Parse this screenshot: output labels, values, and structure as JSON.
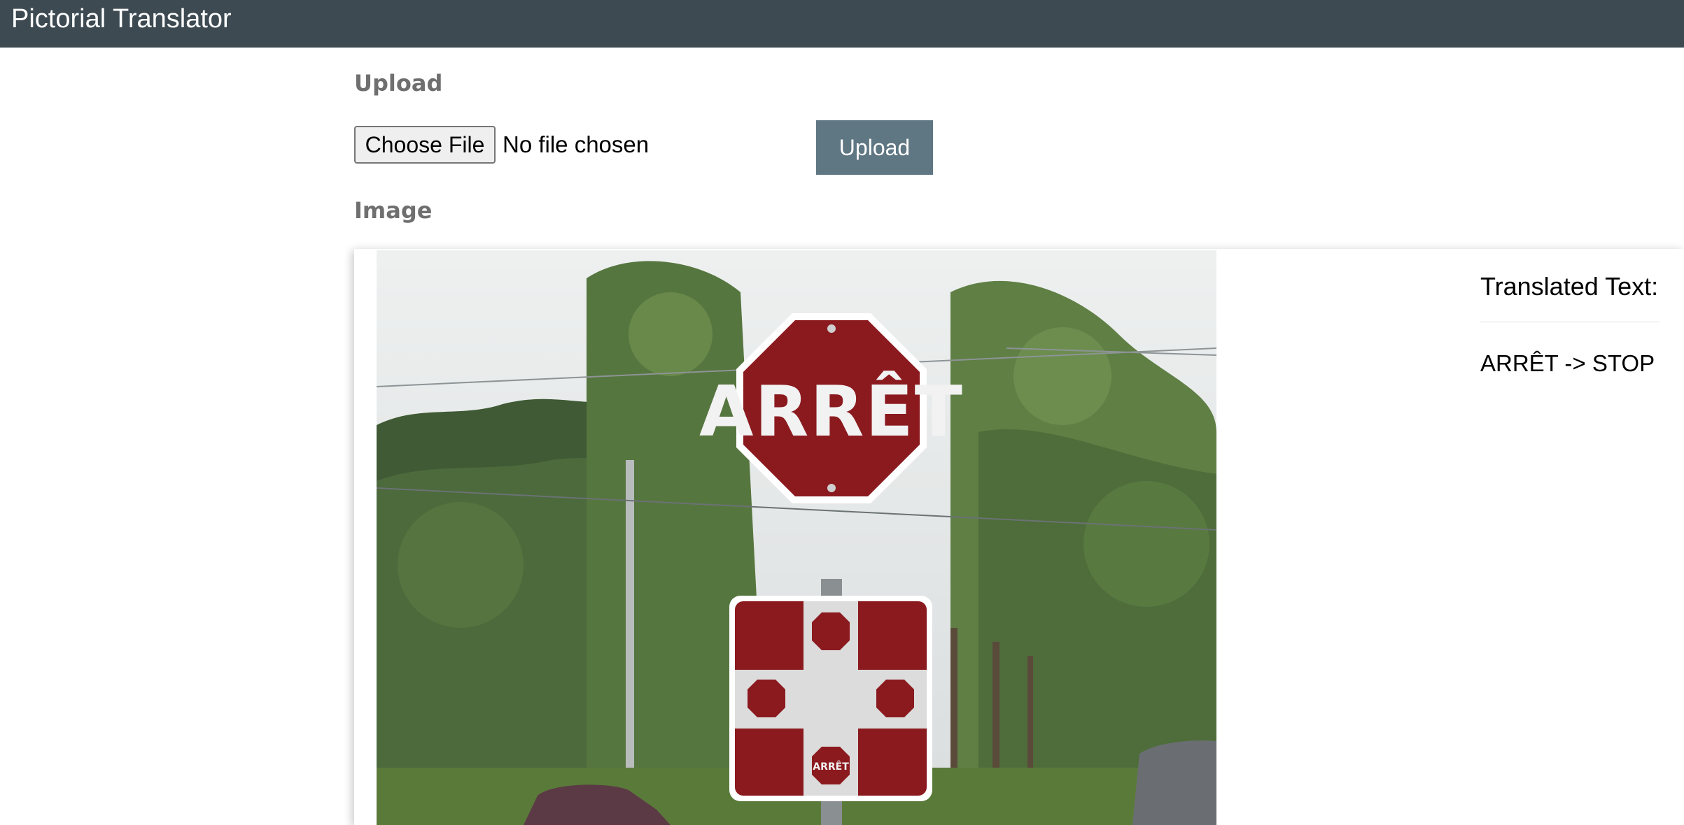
{
  "header": {
    "title": "Pictorial Translator"
  },
  "upload": {
    "section_label": "Upload",
    "choose_file_label": "Choose File",
    "file_status": "No file chosen",
    "submit_label": "Upload"
  },
  "image": {
    "section_label": "Image",
    "sign_text": "ARRÊT",
    "sub_sign_text": "ARRÊT"
  },
  "translation": {
    "title": "Translated Text:",
    "result": "ARRÊT -> STOP"
  },
  "colors": {
    "header_bg": "#3d4a52",
    "upload_button_bg": "#5f7683",
    "label_gray": "#6f6f6f",
    "sign_red": "#8b1a1f"
  }
}
